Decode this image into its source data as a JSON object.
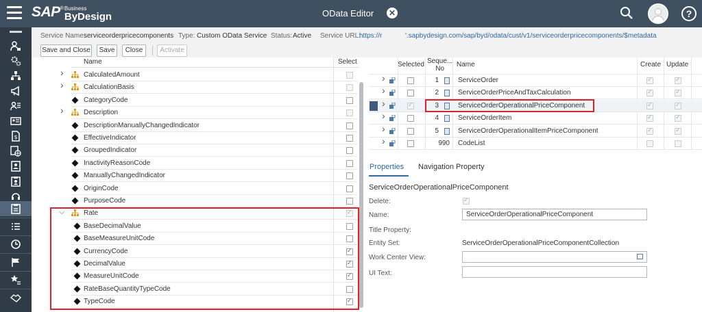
{
  "header": {
    "logo_brand": "SAP",
    "logo_reg": "®",
    "logo_business": "Business",
    "logo_product": "ByDesign",
    "app_title": "OData Editor"
  },
  "info": {
    "service_name_label": "Service Name:",
    "service_name": "serviceorderpricecomponents",
    "type_label": "Type:",
    "type": "Custom OData Service",
    "status_label": "Status:",
    "status": "Active",
    "url_label": "Service URL:",
    "url_part1": "https://r",
    "url_part2": "'.sapbydesign.com/sap/byd/odata/cust/v1/serviceorderpricecomponents/$metadata"
  },
  "toolbar": {
    "save_close": "Save and Close",
    "save": "Save",
    "close": "Close",
    "activate": "Activate"
  },
  "left_table": {
    "col_name": "Name",
    "col_select": "Select",
    "rows": [
      {
        "label": "CalculatedAmount",
        "type": "node",
        "expand": "collapsed",
        "checked": false,
        "disabled": true,
        "indent": 0
      },
      {
        "label": "CalculationBasis",
        "type": "node",
        "expand": "collapsed",
        "checked": false,
        "disabled": true,
        "indent": 0
      },
      {
        "label": "CategoryCode",
        "type": "leaf",
        "checked": false,
        "disabled": false,
        "indent": 0
      },
      {
        "label": "Description",
        "type": "node",
        "expand": "collapsed",
        "checked": false,
        "disabled": true,
        "indent": 0
      },
      {
        "label": "DescriptionManuallyChangedIndicator",
        "type": "leaf",
        "checked": false,
        "disabled": false,
        "indent": 0
      },
      {
        "label": "EffectiveIndicator",
        "type": "leaf",
        "checked": false,
        "disabled": false,
        "indent": 0
      },
      {
        "label": "GroupedIndicator",
        "type": "leaf",
        "checked": false,
        "disabled": false,
        "indent": 0
      },
      {
        "label": "InactivityReasonCode",
        "type": "leaf",
        "checked": false,
        "disabled": false,
        "indent": 0
      },
      {
        "label": "ManuallyChangedIndicator",
        "type": "leaf",
        "checked": false,
        "disabled": false,
        "indent": 0
      },
      {
        "label": "OriginCode",
        "type": "leaf",
        "checked": false,
        "disabled": false,
        "indent": 0
      },
      {
        "label": "PurposeCode",
        "type": "leaf",
        "checked": false,
        "disabled": false,
        "indent": 0
      },
      {
        "label": "Rate",
        "type": "node",
        "expand": "expanded",
        "checked": true,
        "disabled": true,
        "indent": 0
      },
      {
        "label": "BaseDecimalValue",
        "type": "leaf",
        "checked": false,
        "disabled": false,
        "indent": 1
      },
      {
        "label": "BaseMeasureUnitCode",
        "type": "leaf",
        "checked": false,
        "disabled": false,
        "indent": 1
      },
      {
        "label": "CurrencyCode",
        "type": "leaf",
        "checked": true,
        "disabled": false,
        "indent": 1
      },
      {
        "label": "DecimalValue",
        "type": "leaf",
        "checked": true,
        "disabled": false,
        "indent": 1
      },
      {
        "label": "MeasureUnitCode",
        "type": "leaf",
        "checked": true,
        "disabled": false,
        "indent": 1
      },
      {
        "label": "RateBaseQuantityTypeCode",
        "type": "leaf",
        "checked": false,
        "disabled": false,
        "indent": 1
      },
      {
        "label": "TypeCode",
        "type": "leaf",
        "checked": true,
        "disabled": false,
        "indent": 1
      }
    ]
  },
  "right_table": {
    "col_selected": "Selected",
    "col_seq_line1": "Seque...",
    "col_seq_line2": "No",
    "col_name": "Name",
    "col_create": "Create",
    "col_update": "Update",
    "rows": [
      {
        "seq": "1",
        "name": "ServiceOrder",
        "selected": false,
        "create": true,
        "update": true,
        "active": false,
        "calc": true
      },
      {
        "seq": "2",
        "name": "ServiceOrderPriceAndTaxCalculation",
        "selected": false,
        "create": true,
        "update": true,
        "active": false,
        "calc": true
      },
      {
        "seq": "3",
        "name": "ServiceOrderOperationalPriceComponent",
        "selected": true,
        "create": true,
        "update": true,
        "active": true,
        "calc": true
      },
      {
        "seq": "4",
        "name": "ServiceOrderItem",
        "selected": false,
        "create": true,
        "update": true,
        "active": false,
        "calc": true
      },
      {
        "seq": "5",
        "name": "ServiceOrderOperationalItemPriceComponent",
        "selected": false,
        "create": true,
        "update": true,
        "active": false,
        "calc": true
      },
      {
        "seq": "990",
        "name": "CodeList",
        "selected": false,
        "create": false,
        "update": false,
        "active": false,
        "calc": false
      }
    ]
  },
  "tabs": {
    "properties": "Properties",
    "navigation": "Navigation Property"
  },
  "properties": {
    "title": "ServiceOrderOperationalPriceComponent",
    "delete_label": "Delete:",
    "delete_checked": true,
    "name_label": "Name:",
    "name_value": "ServiceOrderOperationalPriceComponent",
    "title_property_label": "Title Property:",
    "entity_set_label": "Entity Set:",
    "entity_set_value": "ServiceOrderOperationalPriceComponentCollection",
    "work_center_label": "Work Center View:",
    "work_center_value": "",
    "ui_text_label": "UI Text:",
    "ui_text_value": ""
  },
  "sidebar": {
    "icons": [
      "bar-icon",
      "person-lock-icon",
      "gears-icon",
      "org-hierarchy-icon",
      "megaphone-icon",
      "person-list-icon",
      "id-card-icon",
      "document-currency-icon",
      "globe-doc-icon",
      "contact-card-icon",
      "clipboard-person-icon",
      "headset-icon",
      "clipboard-check-icon",
      "list-icon",
      "clock-icon",
      "flag-icon",
      "star-list-icon",
      "handshake-icon"
    ]
  },
  "colors": {
    "shell": "#3f5161",
    "sidebar": "#2f3c48",
    "accent": "#2a6aa8",
    "highlight_box": "#e1202c"
  }
}
